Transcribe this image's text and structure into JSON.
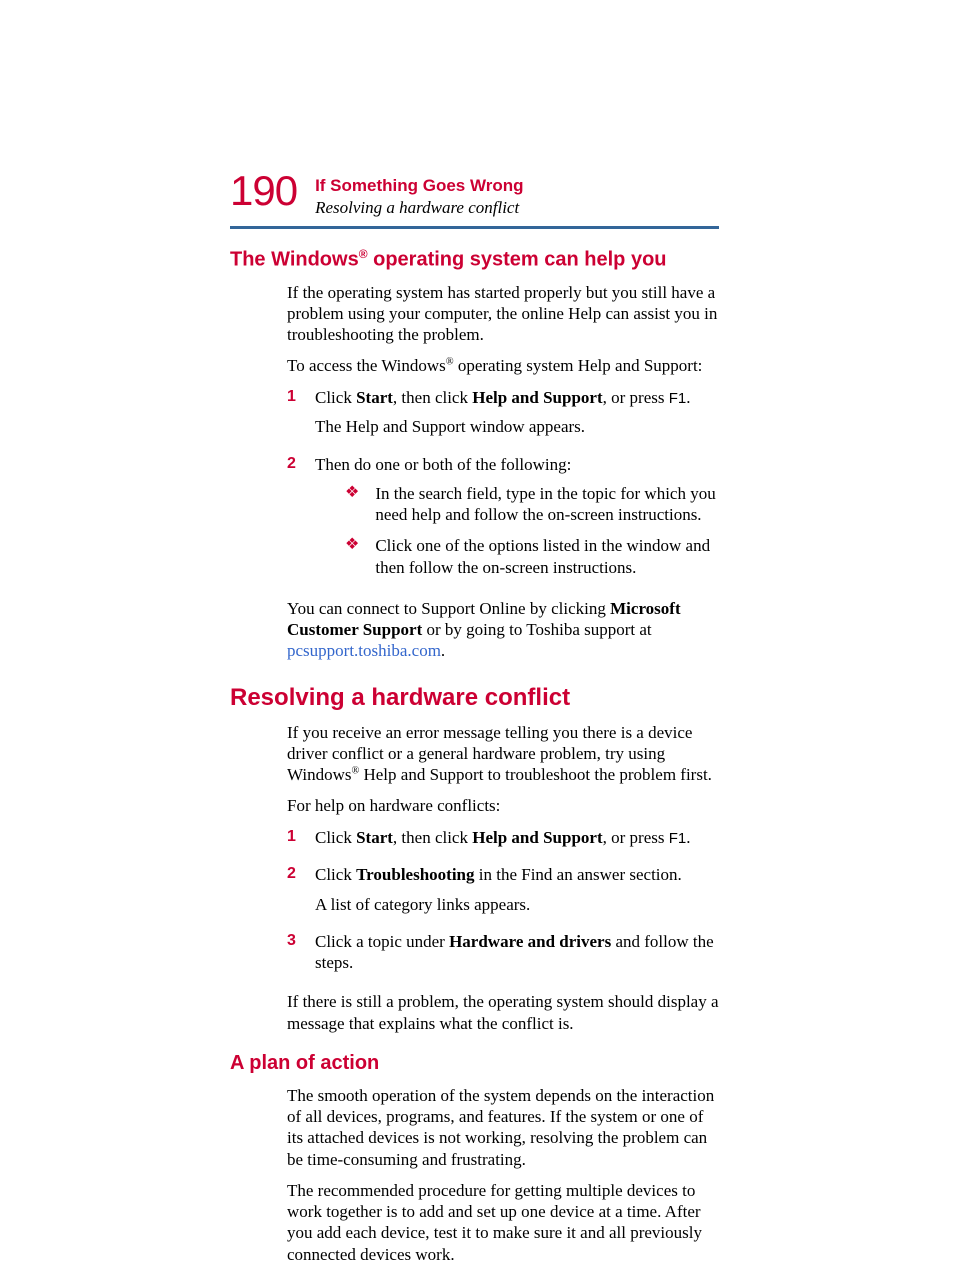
{
  "header": {
    "page_number": "190",
    "chapter": "If Something Goes Wrong",
    "subtitle": "Resolving a hardware conflict"
  },
  "s1": {
    "heading_pre": "The Windows",
    "heading_post": " operating system can help you",
    "p1": "If the operating system has started properly but you still have a problem using your computer, the online Help can assist you in troubleshooting the problem.",
    "p2_pre": "To access the Windows",
    "p2_post": " operating system Help and Support:",
    "step1": {
      "num": "1",
      "t1": "Click ",
      "t2": "Start",
      "t3": ", then click ",
      "t4": "Help and Support",
      "t5": ", or press ",
      "t6": "F1",
      "t7": ".",
      "p2": "The Help and Support window appears."
    },
    "step2": {
      "num": "2",
      "t1": "Then do one or both of the following:",
      "b1": "In the search field, type in the topic for which you need help and follow the on-screen instructions.",
      "b2": "Click one of the options listed in the window and then follow the on-screen instructions."
    },
    "p3_a": "You can connect to Support Online by clicking ",
    "p3_b": "Microsoft Customer Support",
    "p3_c": " or by going to Toshiba support at ",
    "p3_link": "pcsupport.toshiba.com",
    "p3_d": "."
  },
  "s2": {
    "heading": "Resolving a hardware conflict",
    "p1_a": "If you receive an error message telling you there is a device driver conflict or a general hardware problem, try using Windows",
    "p1_b": " Help and Support to troubleshoot the problem first.",
    "p2": "For help on hardware conflicts:",
    "step1": {
      "num": "1",
      "t1": "Click ",
      "t2": "Start",
      "t3": ", then click ",
      "t4": "Help and Support",
      "t5": ", or press ",
      "t6": "F1",
      "t7": "."
    },
    "step2": {
      "num": "2",
      "t1": "Click ",
      "t2": "Troubleshooting",
      "t3": " in the Find an answer section.",
      "p2": "A list of category links appears."
    },
    "step3": {
      "num": "3",
      "t1": "Click a topic under ",
      "t2": "Hardware and drivers",
      "t3": " and follow the steps."
    },
    "p3": "If there is still a problem, the operating system should display a message that explains what the conflict is."
  },
  "s3": {
    "heading": "A plan of action",
    "p1": "The smooth operation of the system depends on the interaction of all devices, programs, and features. If the system or one of its attached devices is not working, resolving the problem can be time-consuming and frustrating.",
    "p2": "The recommended procedure for getting multiple devices to work together is to add and set up one device at a time. After you add each device, test it to make sure it and all previously connected devices work."
  },
  "glyphs": {
    "reg": "®",
    "diamond": "❖"
  }
}
